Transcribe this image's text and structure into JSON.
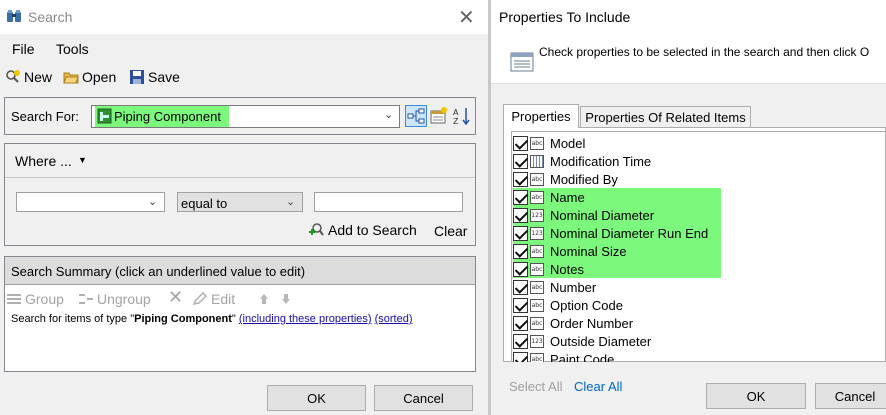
{
  "search_window": {
    "title": "Search",
    "close_glyph": "✕",
    "menu": [
      "File",
      "Tools"
    ],
    "toolbar": {
      "new": "New",
      "open": "Open",
      "save": "Save"
    },
    "search_for": {
      "label": "Search For:",
      "value": "Piping Component"
    },
    "where": {
      "label": "Where ...",
      "property": "",
      "operator": "equal to",
      "value": "",
      "add": "Add to Search",
      "clear": "Clear"
    },
    "summary": {
      "title": "Search Summary (click an underlined value to edit)",
      "toolbar": {
        "group": "Group",
        "ungroup": "Ungroup",
        "edit": "Edit"
      },
      "text_prefix": "Search for items of type \"",
      "type": "Piping Component",
      "text_mid": "\" ",
      "link1": "(including these properties)",
      "link2": "(sorted)"
    },
    "buttons": {
      "ok": "OK",
      "cancel": "Cancel"
    }
  },
  "properties_window": {
    "title": "Properties To Include",
    "banner": "Check properties to be selected in the search and then click O",
    "tabs": [
      "Properties",
      "Properties Of Related Items"
    ],
    "items": [
      {
        "label": "Model",
        "type": "abc",
        "checked": true,
        "highlighted": false
      },
      {
        "label": "Modification Time",
        "type": "date",
        "checked": true,
        "highlighted": false
      },
      {
        "label": "Modified By",
        "type": "abc",
        "checked": true,
        "highlighted": false
      },
      {
        "label": "Name",
        "type": "abc",
        "checked": true,
        "highlighted": true
      },
      {
        "label": "Nominal Diameter",
        "type": "123",
        "checked": true,
        "highlighted": true
      },
      {
        "label": "Nominal Diameter Run End",
        "type": "123",
        "checked": true,
        "highlighted": true
      },
      {
        "label": "Nominal Size",
        "type": "abc",
        "checked": true,
        "highlighted": true
      },
      {
        "label": "Notes",
        "type": "abc",
        "checked": true,
        "highlighted": true
      },
      {
        "label": "Number",
        "type": "abc",
        "checked": true,
        "highlighted": false
      },
      {
        "label": "Option Code",
        "type": "abc",
        "checked": true,
        "highlighted": false
      },
      {
        "label": "Order Number",
        "type": "abc",
        "checked": true,
        "highlighted": false
      },
      {
        "label": "Outside Diameter",
        "type": "123",
        "checked": true,
        "highlighted": false
      },
      {
        "label": "Paint Code",
        "type": "abc",
        "checked": true,
        "highlighted": false
      }
    ],
    "select_all": "Select All",
    "clear_all": "Clear All",
    "buttons": {
      "ok": "OK",
      "cancel": "Cancel"
    }
  },
  "colors": {
    "highlight": "#7cf87c",
    "link": "#1a0dab"
  }
}
